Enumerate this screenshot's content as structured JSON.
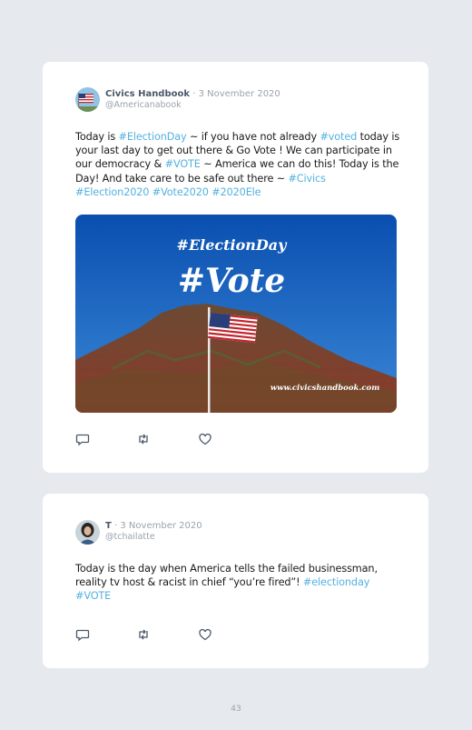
{
  "tweets": [
    {
      "author": "Civics Handbook",
      "separator": "·",
      "date": "3 November 2020",
      "handle": "@Americanabook",
      "text_parts": [
        {
          "t": "Today is ",
          "tag": false
        },
        {
          "t": "#ElectionDay",
          "tag": true
        },
        {
          "t": " ~ if you have not already ",
          "tag": false
        },
        {
          "t": "#voted",
          "tag": true
        },
        {
          "t": " today is your last day to get out there & Go Vote ! We can participate in our democracy & ",
          "tag": false
        },
        {
          "t": "#VOTE",
          "tag": true
        },
        {
          "t": " ~ America we can do this! Today is the Day! And take care to be safe out there ~ ",
          "tag": false
        },
        {
          "t": "#Civics #Election2020 #Vote2020 #2020Ele",
          "tag": true
        }
      ],
      "media": {
        "line1": "#ElectionDay",
        "line2": "#Vote",
        "watermark": "www.civicshandbook.com"
      },
      "actions": [
        "reply-icon",
        "retweet-icon",
        "like-icon"
      ]
    },
    {
      "author": "T",
      "separator": "·",
      "date": "3 November 2020",
      "handle": "@tchailatte",
      "text_parts": [
        {
          "t": "Today is the day when America tells the failed businessman, reality tv host & racist in chief “you’re fired”! ",
          "tag": false
        },
        {
          "t": "#electionday #VOTE",
          "tag": true
        }
      ],
      "actions": [
        "reply-icon",
        "retweet-icon",
        "like-icon"
      ]
    }
  ],
  "page_number": "43",
  "colors": {
    "hashtag": "#54b1e0",
    "name": "#4a5868",
    "muted": "#9aa3ad",
    "background": "#e6e9ee"
  }
}
